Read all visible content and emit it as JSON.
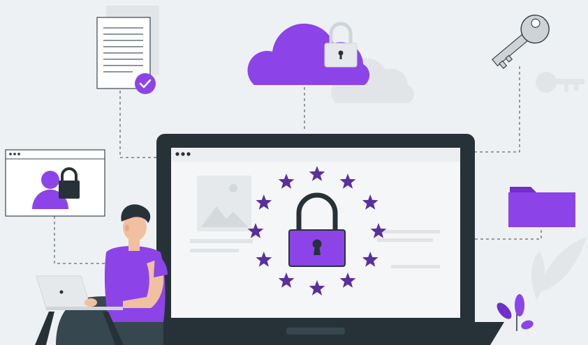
{
  "scene": {
    "colors": {
      "background": "#eef1f3",
      "accent": "#8c44e8",
      "accent_dark": "#5a2f9e",
      "dark": "#263238",
      "light": "#ffffff",
      "faint": "#dfe3e6"
    },
    "icons": {
      "document": "document-icon",
      "check": "check-icon",
      "cloud": "cloud-icon",
      "cloud_lock": "padlock-icon",
      "key": "key-icon",
      "user_window": "browser-window-icon",
      "user": "user-icon",
      "user_lock": "padlock-icon",
      "laptop": "laptop-icon",
      "screen_lock": "padlock-icon",
      "folder": "folder-icon",
      "plant": "plant-icon",
      "person": "person-icon",
      "small_laptop": "laptop-icon"
    },
    "stars_count": 12
  }
}
